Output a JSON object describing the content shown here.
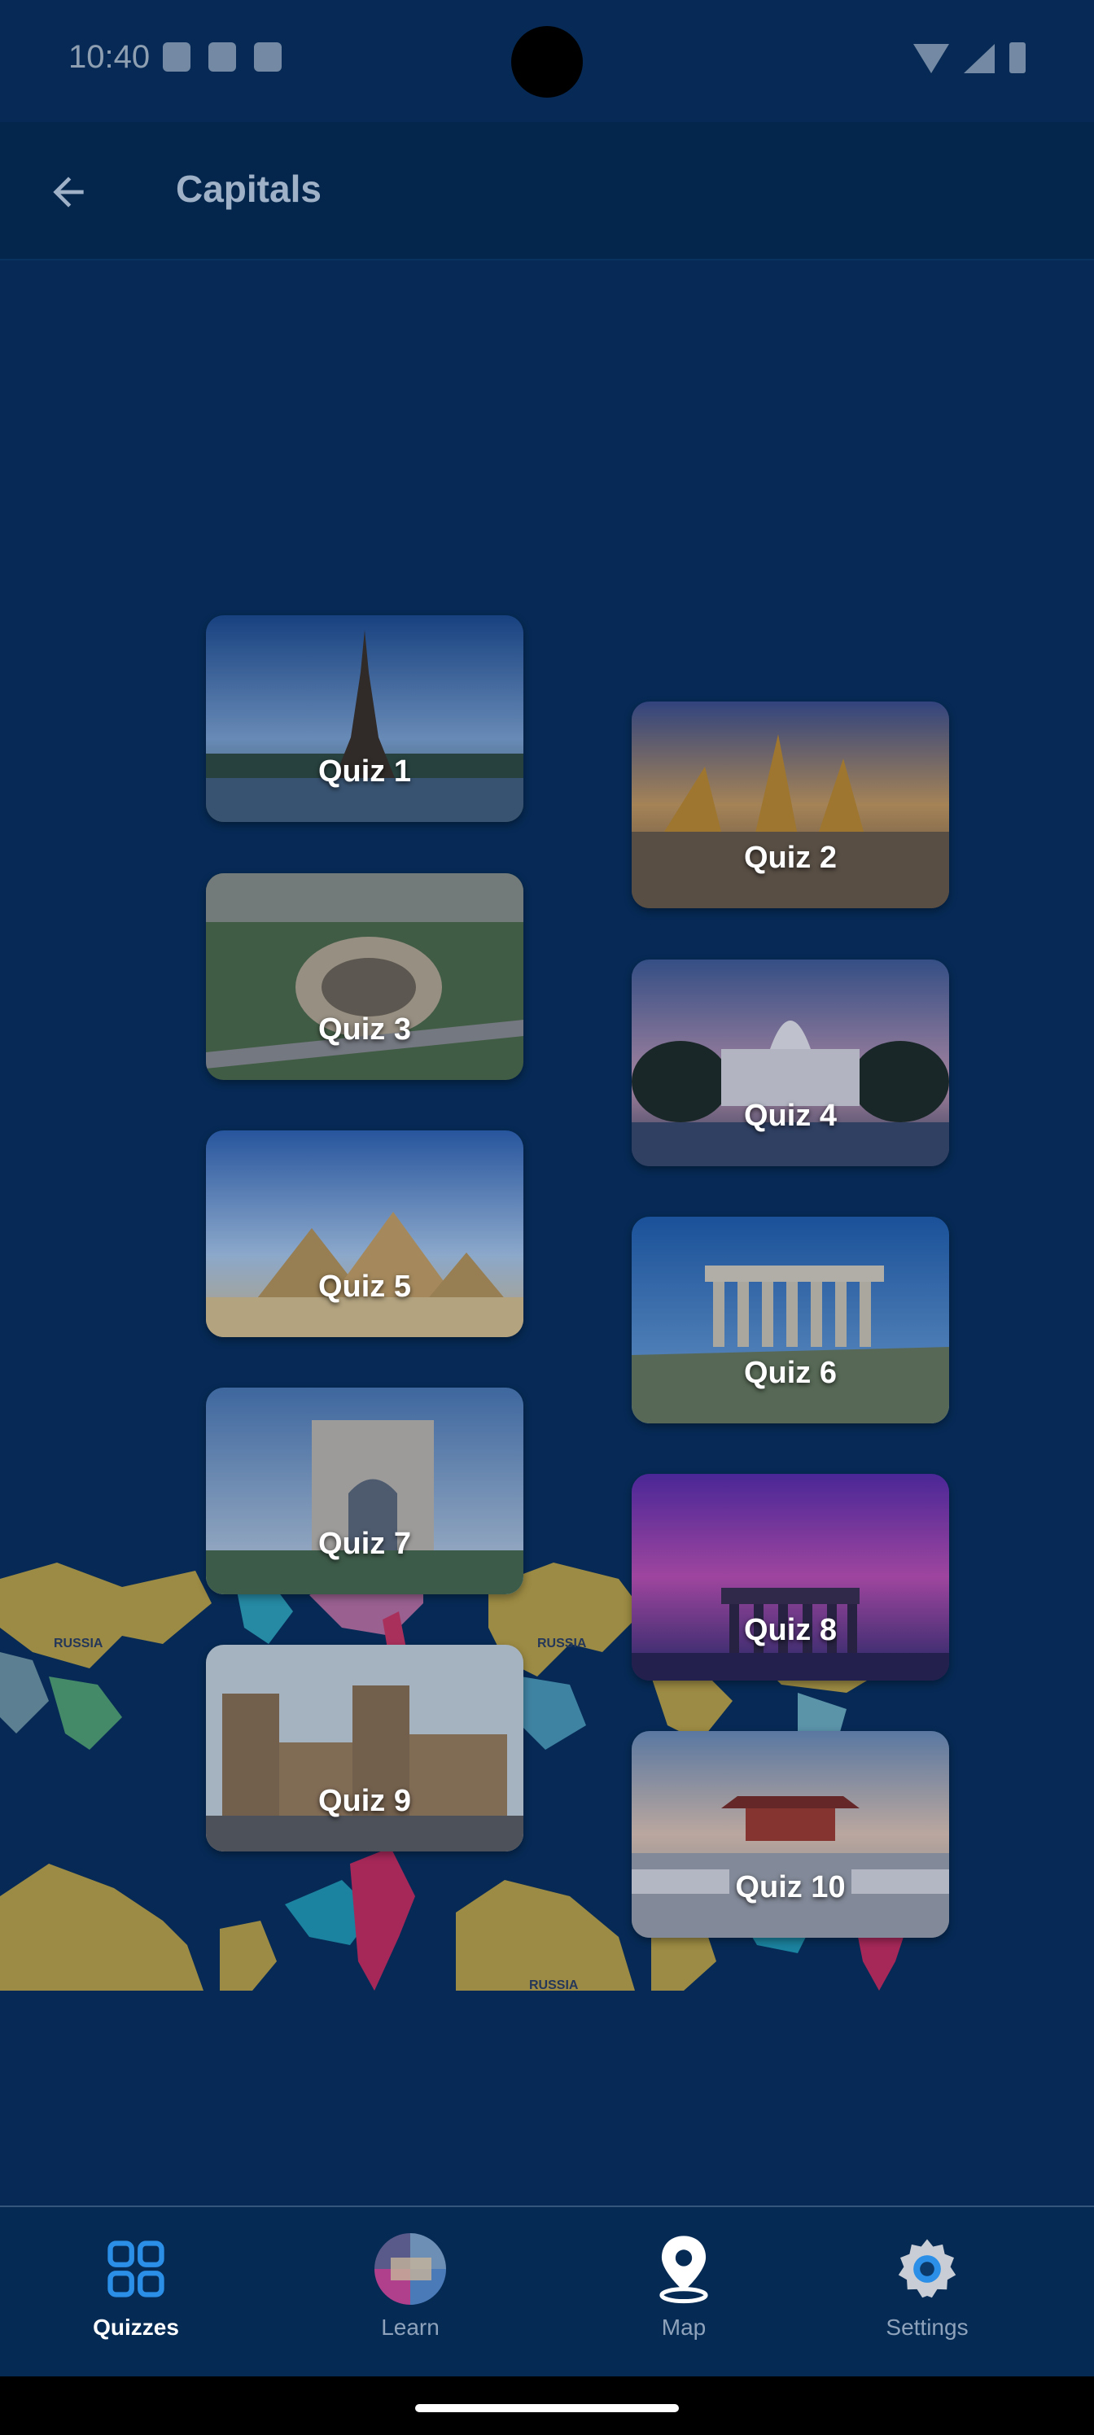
{
  "status_bar": {
    "time": "10:40",
    "icons_left": [
      "shield-icon",
      "sd-card-icon",
      "accessibility-icon"
    ],
    "icons_right": [
      "wifi-icon",
      "signal-icon",
      "battery-icon"
    ]
  },
  "app_bar": {
    "back_icon": "arrow-left-icon",
    "title": "Capitals"
  },
  "quizzes": [
    {
      "label": "Quiz 1",
      "landmark": "Eiffel Tower"
    },
    {
      "label": "Quiz 2",
      "landmark": "Grand Palace"
    },
    {
      "label": "Quiz 3",
      "landmark": "Colosseum"
    },
    {
      "label": "Quiz 4",
      "landmark": "US Capitol"
    },
    {
      "label": "Quiz 5",
      "landmark": "Pyramids of Giza"
    },
    {
      "label": "Quiz 6",
      "landmark": "Parthenon"
    },
    {
      "label": "Quiz 7",
      "landmark": "Arc de Triomphe"
    },
    {
      "label": "Quiz 8",
      "landmark": "Brandenburg Gate"
    },
    {
      "label": "Quiz 9",
      "landmark": "Metropolitan Cathedral"
    },
    {
      "label": "Quiz 10",
      "landmark": "Forbidden City"
    }
  ],
  "background_map_labels": [
    "RUSSIA",
    "RUSSIA",
    "RUSSIA"
  ],
  "bottom_nav": {
    "items": [
      {
        "label": "Quizzes",
        "icon": "grid-icon",
        "active": true
      },
      {
        "label": "Learn",
        "icon": "globe-thumbnail-icon",
        "active": false
      },
      {
        "label": "Map",
        "icon": "map-pin-icon",
        "active": false
      },
      {
        "label": "Settings",
        "icon": "gear-icon",
        "active": false
      }
    ]
  },
  "colors": {
    "background": "#062a55",
    "app_bar": "#04264c",
    "active_icon": "#2b8fe8",
    "title_text": "#9fb1c7"
  }
}
